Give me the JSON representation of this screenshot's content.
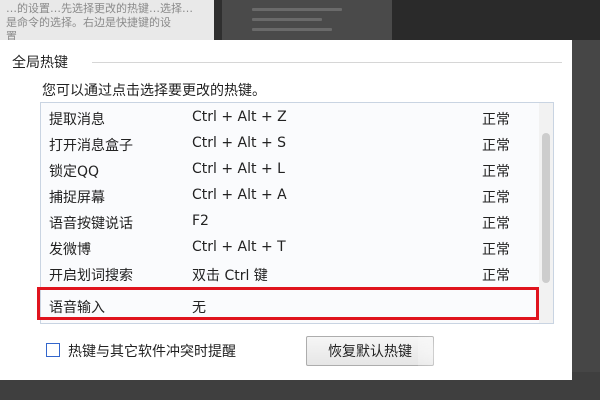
{
  "background": {
    "left_panel_text": "…的设置…先选择更改的热键…选择…\n是命令的选择。右边是快捷键的设\n置"
  },
  "dialog": {
    "group_title": "全局热键",
    "description": "您可以通过点击选择要更改的热键。",
    "hotkeys": [
      {
        "action": "提取消息",
        "keys": "Ctrl + Alt + Z",
        "status": "正常"
      },
      {
        "action": "打开消息盒子",
        "keys": "Ctrl + Alt + S",
        "status": "正常"
      },
      {
        "action": "锁定QQ",
        "keys": "Ctrl + Alt + L",
        "status": "正常"
      },
      {
        "action": "捕捉屏幕",
        "keys": "Ctrl + Alt + A",
        "status": "正常"
      },
      {
        "action": "语音按键说话",
        "keys": "F2",
        "status": "正常"
      },
      {
        "action": "发微博",
        "keys": "Ctrl + Alt + T",
        "status": "正常"
      },
      {
        "action": "开启划词搜索",
        "keys": "双击 Ctrl 键",
        "status": "正常"
      },
      {
        "action": "语音输入",
        "keys": "无",
        "status": ""
      }
    ],
    "conflict_checkbox_label": "热键与其它软件冲突时提醒",
    "conflict_checkbox_checked": false,
    "restore_button_label": "恢复默认热键"
  },
  "colors": {
    "highlight": "#e0141e",
    "checkbox_border": "#3366cc",
    "list_border": "#c9d4e2"
  }
}
